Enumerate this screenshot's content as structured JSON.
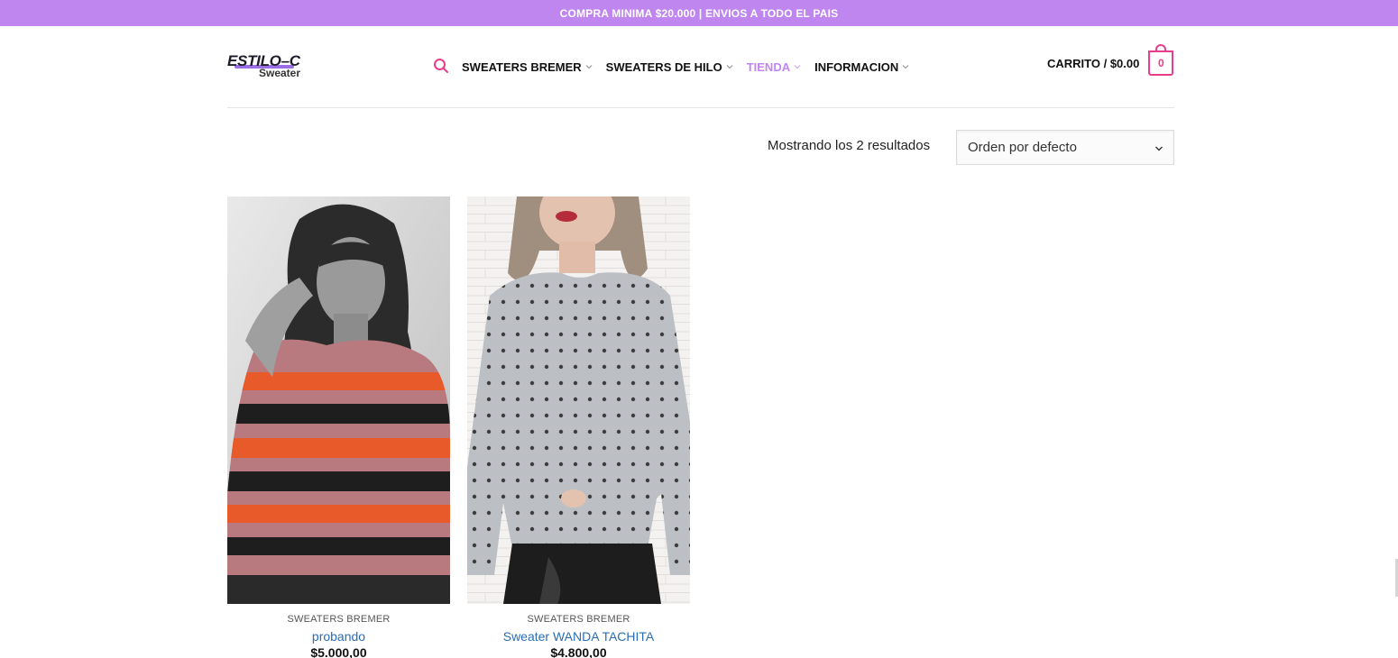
{
  "topbar": {
    "text": "COMPRA MINIMA $20.000 | ENVIOS A TODO EL PAIS"
  },
  "logo": {
    "main": "ESTILO–C",
    "sub": "Sweater"
  },
  "nav": {
    "items": [
      {
        "label": "SWEATERS BREMER"
      },
      {
        "label": "SWEATERS DE HILO"
      },
      {
        "label": "TIENDA"
      },
      {
        "label": "INFORMACION"
      }
    ]
  },
  "cart": {
    "label": "CARRITO / $0.00",
    "count": "0"
  },
  "shop": {
    "result_count": "Mostrando los 2 resultados",
    "orderby_selected": "Orden por defecto"
  },
  "products": [
    {
      "category": "SWEATERS BREMER",
      "name": "probando",
      "price": "$5.000,00"
    },
    {
      "category": "SWEATERS BREMER",
      "name": "Sweater WANDA TACHITA",
      "price": "$4.800,00"
    }
  ],
  "colors": {
    "topbar_bg": "#c086f0",
    "accent_pink": "#e83e8c",
    "nav_active": "#c086f0",
    "link_blue": "#2a6db5"
  },
  "icons": [
    "search-icon",
    "chevron-down-icon",
    "cart-icon"
  ]
}
